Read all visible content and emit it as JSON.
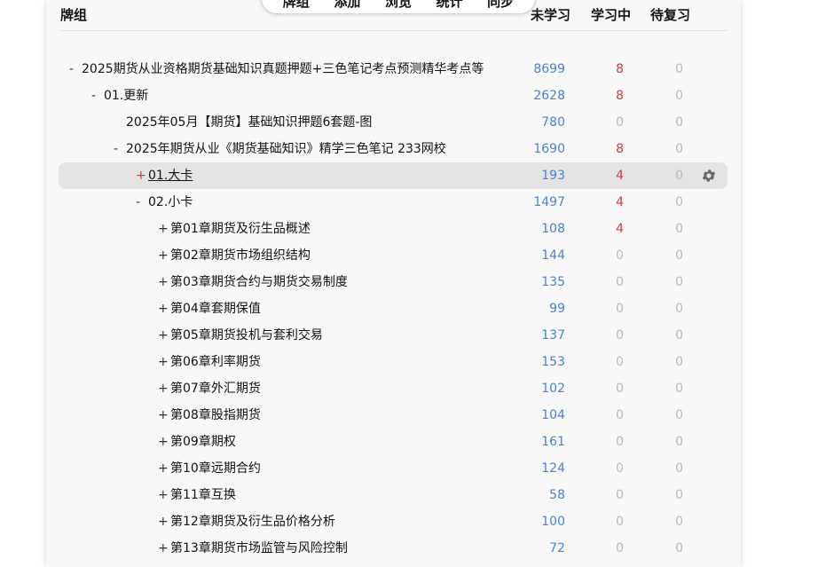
{
  "toolbar": {
    "items": [
      "牌组",
      "添加",
      "浏览",
      "统计",
      "同步"
    ]
  },
  "header": {
    "deck": "牌组",
    "due": "未学习",
    "learning": "学习中",
    "review": "待复习"
  },
  "rows": [
    {
      "collapse": "-",
      "name": "2025期货从业资格期货基础知识真题押题+三色笔记考点预测精华考点等",
      "new": "8699",
      "learn": "8",
      "review": "0"
    },
    {
      "collapse": "-",
      "name": "01.更新",
      "new": "2628",
      "learn": "8",
      "review": "0"
    },
    {
      "collapse": "",
      "name": "2025年05月【期货】基础知识押题6套题-图",
      "new": "780",
      "learn": "0",
      "review": "0"
    },
    {
      "collapse": "-",
      "name": "2025年期货从业《期货基础知识》精学三色笔记 233网校",
      "new": "1690",
      "learn": "8",
      "review": "0"
    },
    {
      "collapse": "+",
      "name": "01.大卡",
      "new": "193",
      "learn": "4",
      "review": "0"
    },
    {
      "collapse": "-",
      "name": "02.小卡",
      "new": "1497",
      "learn": "4",
      "review": "0"
    },
    {
      "collapse": "+",
      "name": "第01章期货及衍生品概述",
      "new": "108",
      "learn": "4",
      "review": "0"
    },
    {
      "collapse": "+",
      "name": "第02章期货市场组织结构",
      "new": "144",
      "learn": "0",
      "review": "0"
    },
    {
      "collapse": "+",
      "name": "第03章期货合约与期货交易制度",
      "new": "135",
      "learn": "0",
      "review": "0"
    },
    {
      "collapse": "+",
      "name": "第04章套期保值",
      "new": "99",
      "learn": "0",
      "review": "0"
    },
    {
      "collapse": "+",
      "name": "第05章期货投机与套利交易",
      "new": "137",
      "learn": "0",
      "review": "0"
    },
    {
      "collapse": "+",
      "name": "第06章利率期货",
      "new": "153",
      "learn": "0",
      "review": "0"
    },
    {
      "collapse": "+",
      "name": "第07章外汇期货",
      "new": "102",
      "learn": "0",
      "review": "0"
    },
    {
      "collapse": "+",
      "name": "第08章股指期货",
      "new": "104",
      "learn": "0",
      "review": "0"
    },
    {
      "collapse": "+",
      "name": "第09章期权",
      "new": "161",
      "learn": "0",
      "review": "0"
    },
    {
      "collapse": "+",
      "name": "第10章远期合约",
      "new": "124",
      "learn": "0",
      "review": "0"
    },
    {
      "collapse": "+",
      "name": "第11章互换",
      "new": "58",
      "learn": "0",
      "review": "0"
    },
    {
      "collapse": "+",
      "name": "第12章期货及衍生品价格分析",
      "new": "100",
      "learn": "0",
      "review": "0"
    },
    {
      "collapse": "+",
      "name": "第13章期货市场监管与风险控制",
      "new": "72",
      "learn": "0",
      "review": "0"
    }
  ],
  "colors": {
    "new": "#4a80d8",
    "learning": "#d43a3a",
    "zero": "#b8b8b8"
  },
  "current_deck": "01.大卡",
  "current_deck_icon": "gear-icon"
}
